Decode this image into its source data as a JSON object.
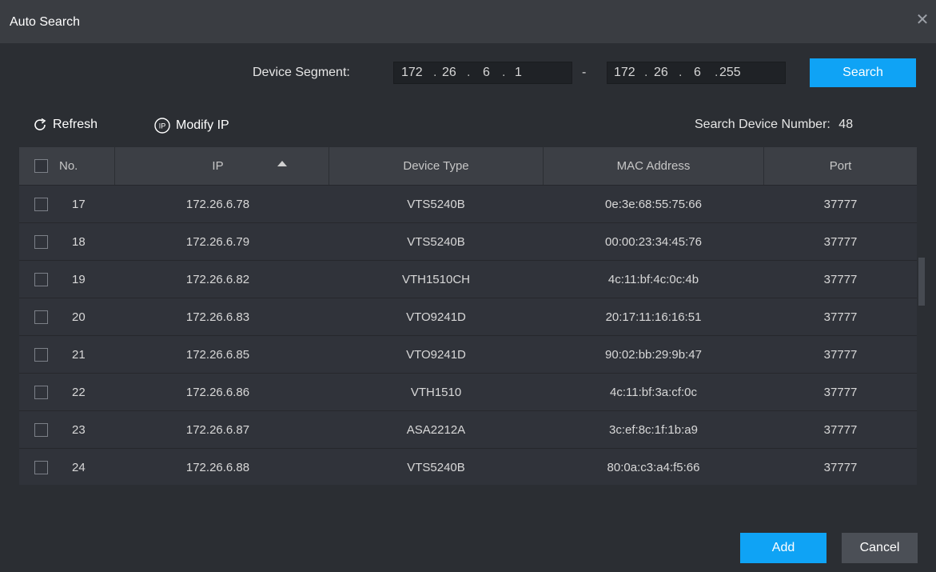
{
  "window": {
    "title": "Auto Search"
  },
  "segment": {
    "label": "Device Segment:",
    "start": [
      "172",
      "26",
      "6",
      "1"
    ],
    "end": [
      "172",
      "26",
      "6",
      "255"
    ],
    "separator": "-",
    "dot": "."
  },
  "buttons": {
    "search": "Search",
    "add": "Add",
    "cancel": "Cancel"
  },
  "toolbar": {
    "refresh": "Refresh",
    "modify_ip": "Modify IP"
  },
  "device_count": {
    "label": "Search Device Number:",
    "value": "48"
  },
  "table": {
    "columns": [
      "No.",
      "IP",
      "Device Type",
      "MAC Address",
      "Port"
    ],
    "rows": [
      {
        "no": "17",
        "ip": "172.26.6.78",
        "type": "VTS5240B",
        "mac": "0e:3e:68:55:75:66",
        "port": "37777"
      },
      {
        "no": "18",
        "ip": "172.26.6.79",
        "type": "VTS5240B",
        "mac": "00:00:23:34:45:76",
        "port": "37777"
      },
      {
        "no": "19",
        "ip": "172.26.6.82",
        "type": "VTH1510CH",
        "mac": "4c:11:bf:4c:0c:4b",
        "port": "37777"
      },
      {
        "no": "20",
        "ip": "172.26.6.83",
        "type": "VTO9241D",
        "mac": "20:17:11:16:16:51",
        "port": "37777"
      },
      {
        "no": "21",
        "ip": "172.26.6.85",
        "type": "VTO9241D",
        "mac": "90:02:bb:29:9b:47",
        "port": "37777"
      },
      {
        "no": "22",
        "ip": "172.26.6.86",
        "type": "VTH1510",
        "mac": "4c:11:bf:3a:cf:0c",
        "port": "37777"
      },
      {
        "no": "23",
        "ip": "172.26.6.87",
        "type": "ASA2212A",
        "mac": "3c:ef:8c:1f:1b:a9",
        "port": "37777"
      },
      {
        "no": "24",
        "ip": "172.26.6.88",
        "type": "VTS5240B",
        "mac": "80:0a:c3:a4:f5:66",
        "port": "37777"
      }
    ]
  },
  "colors": {
    "accent": "#0fa3f5",
    "background": "#2b2e33",
    "header": "#3c3f45"
  }
}
